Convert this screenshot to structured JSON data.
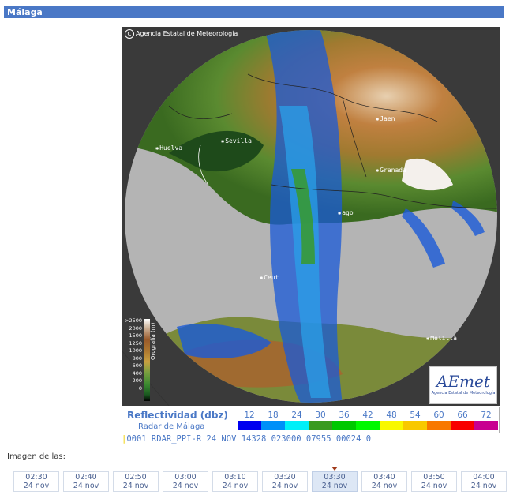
{
  "header": {
    "title": "Málaga"
  },
  "radar": {
    "credit": "Agencia Estatal de Meteorología",
    "copyright_symbol": "C",
    "cities": {
      "jaen": "Jaen",
      "granada": "Granada",
      "sevilla": "Sevilla",
      "huelva": "Huelva",
      "malaga": "ago",
      "ceuta": "Ceut",
      "melilla": "Melilla"
    },
    "orography": {
      "title": "Orografía (m)",
      "levels": [
        ">2500",
        "2000",
        "1500",
        "1250",
        "1000",
        "800",
        "600",
        "400",
        "200",
        "0"
      ]
    },
    "logo": {
      "text": "AEmet",
      "subtitle": "Agencia Estatal de Meteorología"
    }
  },
  "legend": {
    "title": "Reflectividad (dbz)",
    "subtitle": "Radar de Málaga",
    "scale": [
      {
        "value": "12",
        "color": "#0000f0"
      },
      {
        "value": "18",
        "color": "#0090f8"
      },
      {
        "value": "24",
        "color": "#00f0f8"
      },
      {
        "value": "30",
        "color": "#3a9a20"
      },
      {
        "value": "36",
        "color": "#00c800"
      },
      {
        "value": "42",
        "color": "#00f800"
      },
      {
        "value": "48",
        "color": "#f8f800"
      },
      {
        "value": "54",
        "color": "#f8c800"
      },
      {
        "value": "60",
        "color": "#f87800"
      },
      {
        "value": "66",
        "color": "#f80000"
      },
      {
        "value": "72",
        "color": "#c80090"
      }
    ]
  },
  "info_line": {
    "marker": "|",
    "text": "0001 RDAR_PPI-R   24 NOV 14328 023000 07955 00024 0"
  },
  "timeline": {
    "label": "Imagen de las:",
    "selected_index": 6,
    "items": [
      {
        "time": "02:30",
        "date": "24 nov"
      },
      {
        "time": "02:40",
        "date": "24 nov"
      },
      {
        "time": "02:50",
        "date": "24 nov"
      },
      {
        "time": "03:00",
        "date": "24 nov"
      },
      {
        "time": "03:10",
        "date": "24 nov"
      },
      {
        "time": "03:20",
        "date": "24 nov"
      },
      {
        "time": "03:30",
        "date": "24 nov"
      },
      {
        "time": "03:40",
        "date": "24 nov"
      },
      {
        "time": "03:50",
        "date": "24 nov"
      },
      {
        "time": "04:00",
        "date": "24 nov"
      }
    ]
  }
}
